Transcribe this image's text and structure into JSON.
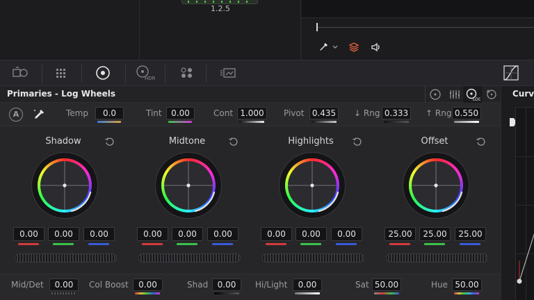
{
  "clip": {
    "version": "1.2.5"
  },
  "panel": {
    "title": "Primaries - Log Wheels"
  },
  "curves": {
    "title": "Curves"
  },
  "adjust": {
    "auto_label": "A",
    "temp": {
      "label": "Temp",
      "value": "0.0"
    },
    "tint": {
      "label": "Tint",
      "value": "0.00"
    },
    "cont": {
      "label": "Cont",
      "value": "1.000"
    },
    "pivot": {
      "label": "Pivot",
      "value": "0.435"
    },
    "low_rng": {
      "label": "↓ Rng",
      "value": "0.333"
    },
    "high_rng": {
      "label": "↑ Rng",
      "value": "0.550"
    }
  },
  "wheels": [
    {
      "name": "Shadow",
      "values": [
        "0.00",
        "0.00",
        "0.00"
      ]
    },
    {
      "name": "Midtone",
      "values": [
        "0.00",
        "0.00",
        "0.00"
      ]
    },
    {
      "name": "Highlights",
      "values": [
        "0.00",
        "0.00",
        "0.00"
      ]
    },
    {
      "name": "Offset",
      "values": [
        "25.00",
        "25.00",
        "25.00"
      ]
    }
  ],
  "bottom": {
    "mid_det": {
      "label": "Mid/Det",
      "value": "0.00"
    },
    "col_boost": {
      "label": "Col Boost",
      "value": "0.00"
    },
    "shad": {
      "label": "Shad",
      "value": "0.00"
    },
    "hi_light": {
      "label": "Hi/Light",
      "value": "0.00"
    },
    "sat": {
      "label": "Sat",
      "value": "50.00"
    },
    "hue": {
      "label": "Hue",
      "value": "50.00"
    }
  },
  "colors": {
    "accent": "#e8e8e8",
    "red": "#d23a3a",
    "green": "#3ac24a",
    "blue": "#3a5ad8",
    "highlight_icon": "#e0603a"
  },
  "icons": {
    "toolbar": [
      "camera-raw-icon",
      "color-match-icon",
      "color-wheels-icon",
      "hdr-wheels-icon",
      "rgb-mixer-icon",
      "motion-effects-icon",
      "curves-icon"
    ],
    "header_modes": [
      "primaries-bars-icon",
      "primaries-wheels-icon",
      "log-wheels-icon",
      "reset-icon"
    ],
    "viewer": [
      "eyedropper-icon",
      "layers-icon",
      "speaker-icon"
    ]
  }
}
